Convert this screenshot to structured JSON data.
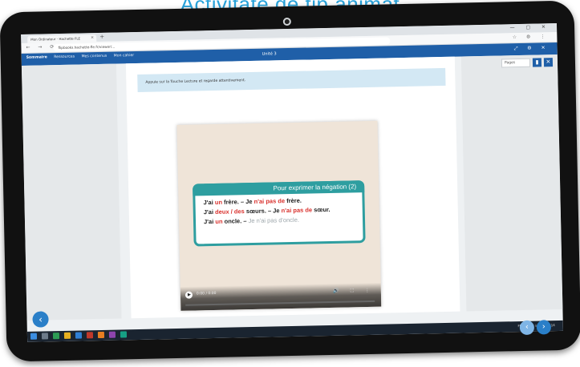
{
  "heading": "Activitate de tip animat",
  "browser": {
    "tab_title": "Mon Ordinateur - Hachette FLE",
    "tab_close": "×",
    "new_tab": "+",
    "url": "flipbooks.hachette-fle.fr/viewer/...",
    "nav_icons": "← → ⟳",
    "window_buttons": "— ▢ ✕",
    "extensions": "☆ ⚙ ⋮"
  },
  "app": {
    "nav": [
      "Sommaire",
      "Ressources",
      "Mes contenus",
      "Mon cahier"
    ],
    "title": "Unité 3",
    "tools": "⤢ ⚙ ✕"
  },
  "side_controls": {
    "page_value": "Pages",
    "toggle_label": "▮",
    "close_label": "✕"
  },
  "instruction_text": "Appuie sur la Touche Lecture et regarde attentivement.",
  "card": {
    "header": "Pour exprimer la négation (2)",
    "line1": {
      "a": "J'ai ",
      "b": "un",
      "c": " frère. – Je ",
      "d": "n'ai pas de",
      "e": " frère."
    },
    "line2": {
      "a": "J'ai ",
      "b": "deux / des",
      "c": " sœurs. – Je ",
      "d": "n'ai pas de",
      "e": " sœur."
    },
    "line3": {
      "a": "J'ai ",
      "b": "un",
      "c": " oncle. – ",
      "d": "Je n'ai pas d'oncle."
    }
  },
  "video": {
    "timecode": "0:00 / 0:00",
    "icons": "🔊 ⛶ ⋮"
  },
  "taskbar": {
    "tray_text": "FRA  Partly sunny  10:14"
  },
  "nav_buttons": {
    "prev": "‹",
    "next_small": "‹",
    "next": "›"
  },
  "colors": {
    "accent": "#1f5fa8",
    "teal": "#2e9ea0",
    "highlight_red": "#d9302c",
    "heading_blue": "#29a3db"
  }
}
